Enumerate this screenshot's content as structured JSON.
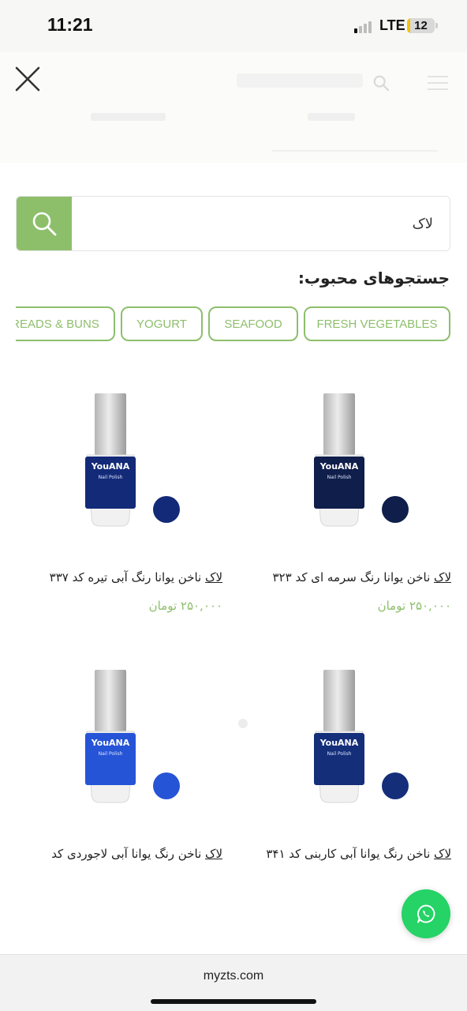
{
  "status_bar": {
    "time": "11:21",
    "network": "LTE",
    "battery_level": "12",
    "battery_fraction": 0.12,
    "signal_bars_active": 1
  },
  "header": {
    "close_icon": "close-icon",
    "menu_icon": "hamburger-menu-icon",
    "search_icon": "search-icon"
  },
  "search": {
    "value": "لاک",
    "button_icon": "search-icon"
  },
  "popular": {
    "title": "جستجوهای محبوب:",
    "tags": [
      "FRESH VEGETABLES",
      "SEAFOOD",
      "YOGURT",
      "BREADS & BUNS"
    ]
  },
  "products": [
    {
      "keyword": "لاک",
      "title_rest": " ناخن یوانا رنگ سرمه ای کد ۳۲۳",
      "price": "۲۵۰,۰۰۰ تومان",
      "brand": "YouANA",
      "subtitle": "Nail Polish",
      "color": "#0f1e4a"
    },
    {
      "keyword": "لاک",
      "title_rest": " ناخن یوانا رنگ آبی تیره کد ۳۳۷",
      "price": "۲۵۰,۰۰۰ تومان",
      "brand": "YouANA",
      "subtitle": "Nail Polish",
      "color": "#132a78"
    },
    {
      "keyword": "لاک",
      "title_rest": " ناخن رنگ یوانا آبی کاربنی کد ۳۴۱",
      "price": "",
      "brand": "YouANA",
      "subtitle": "Nail Polish",
      "color": "#142e7a"
    },
    {
      "keyword": "لاک",
      "title_rest": " ناخن رنگ یوانا آبی لاجوردی کد",
      "price": "",
      "brand": "YouANA",
      "subtitle": "Nail Polish",
      "color": "#2554d6"
    }
  ],
  "floating": {
    "whatsapp_icon": "whatsapp-icon"
  },
  "browser": {
    "url": "myzts.com"
  },
  "colors": {
    "accent": "#8dbf6b",
    "whatsapp": "#25d366",
    "status_bg": "#f7f7f5",
    "battery": "#f4c20d"
  }
}
